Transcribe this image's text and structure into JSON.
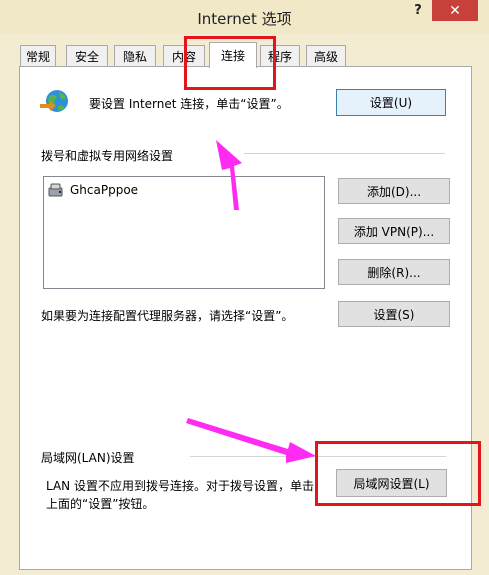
{
  "window": {
    "title": "Internet 选项",
    "help_label": "?",
    "close_label": "✕"
  },
  "tabs": [
    {
      "label": "常规"
    },
    {
      "label": "安全"
    },
    {
      "label": "隐私"
    },
    {
      "label": "内容"
    },
    {
      "label": "连接",
      "active": true
    },
    {
      "label": "程序"
    },
    {
      "label": "高级"
    }
  ],
  "setup": {
    "icon": "globe-network-icon",
    "text": "要设置 Internet 连接，单击“设置”。",
    "button": "设置(U)"
  },
  "dialup": {
    "heading": "拨号和虚拟专用网络设置",
    "connections": [
      {
        "icon": "dialup-connection-icon",
        "name": "GhcaPppoe"
      }
    ],
    "add_button": "添加(D)...",
    "add_vpn_button": "添加 VPN(P)...",
    "delete_button": "删除(R)...",
    "proxy_text": "如果要为连接配置代理服务器，请选择“设置”。",
    "settings_button": "设置(S)"
  },
  "lan": {
    "heading": "局域网(LAN)设置",
    "line1": "LAN 设置不应用到拨号连接。对于拨号设置，单击",
    "line2": "上面的“设置”按钮。",
    "button": "局域网设置(L)"
  },
  "annotations": {
    "highlight_color": "#e4141b",
    "arrow_color": "#ff2bf3"
  }
}
